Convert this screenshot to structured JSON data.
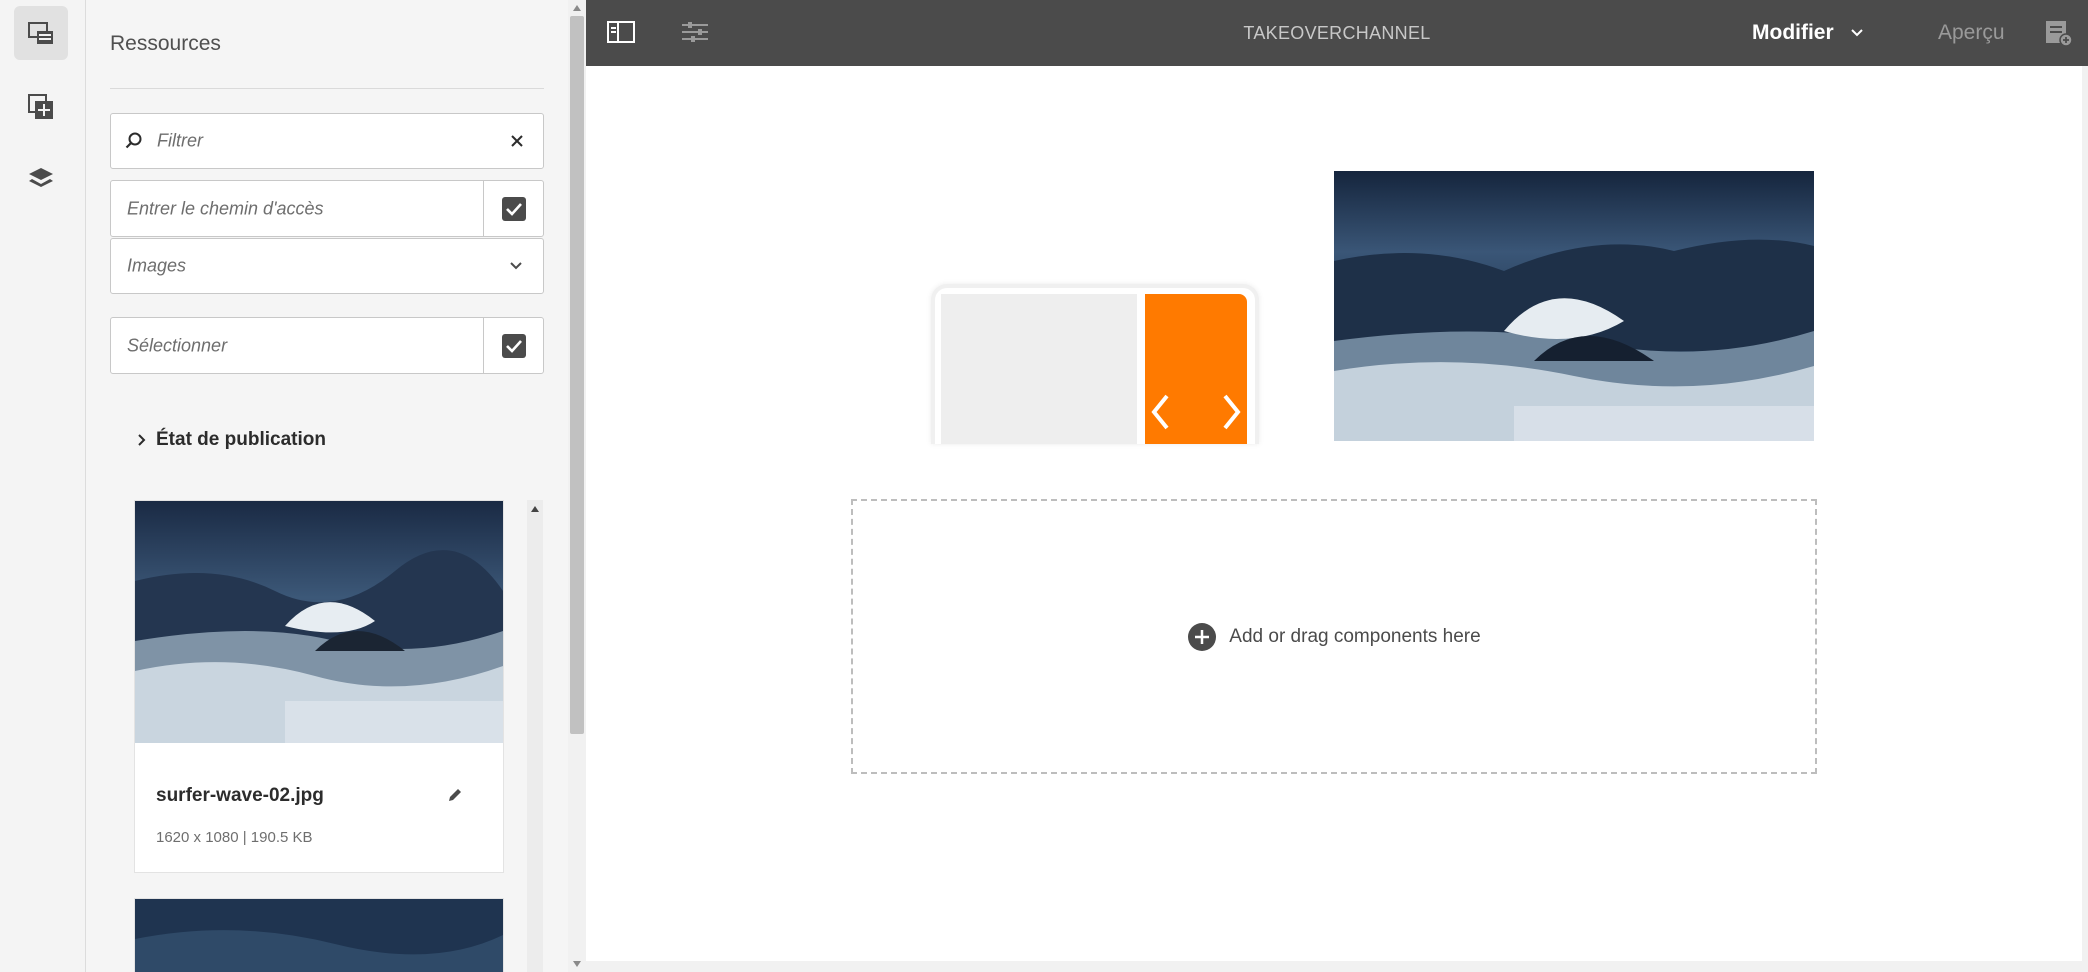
{
  "rail": {
    "items": [
      {
        "icon": "assets-icon",
        "active": true
      },
      {
        "icon": "add-component-icon",
        "active": false
      },
      {
        "icon": "layers-icon",
        "active": false
      }
    ]
  },
  "panel": {
    "title": "Ressources",
    "filter_placeholder": "Filtrer",
    "path_placeholder": "Entrer le chemin d'accès",
    "type_select_value": "Images",
    "select_placeholder": "Sélectionner",
    "publication_label": "État de publication",
    "assets": [
      {
        "name": "surfer-wave-02.jpg",
        "meta": "1620 x 1080 | 190.5 KB"
      }
    ]
  },
  "topbar": {
    "title": "TAKEOVERCHANNEL",
    "mode_label": "Modifier",
    "preview_label": "Aperçu"
  },
  "canvas": {
    "dropzone_label": "Add or drag components here"
  },
  "colors": {
    "accent_orange": "#ff7a00",
    "topbar": "#4b4b4b"
  }
}
